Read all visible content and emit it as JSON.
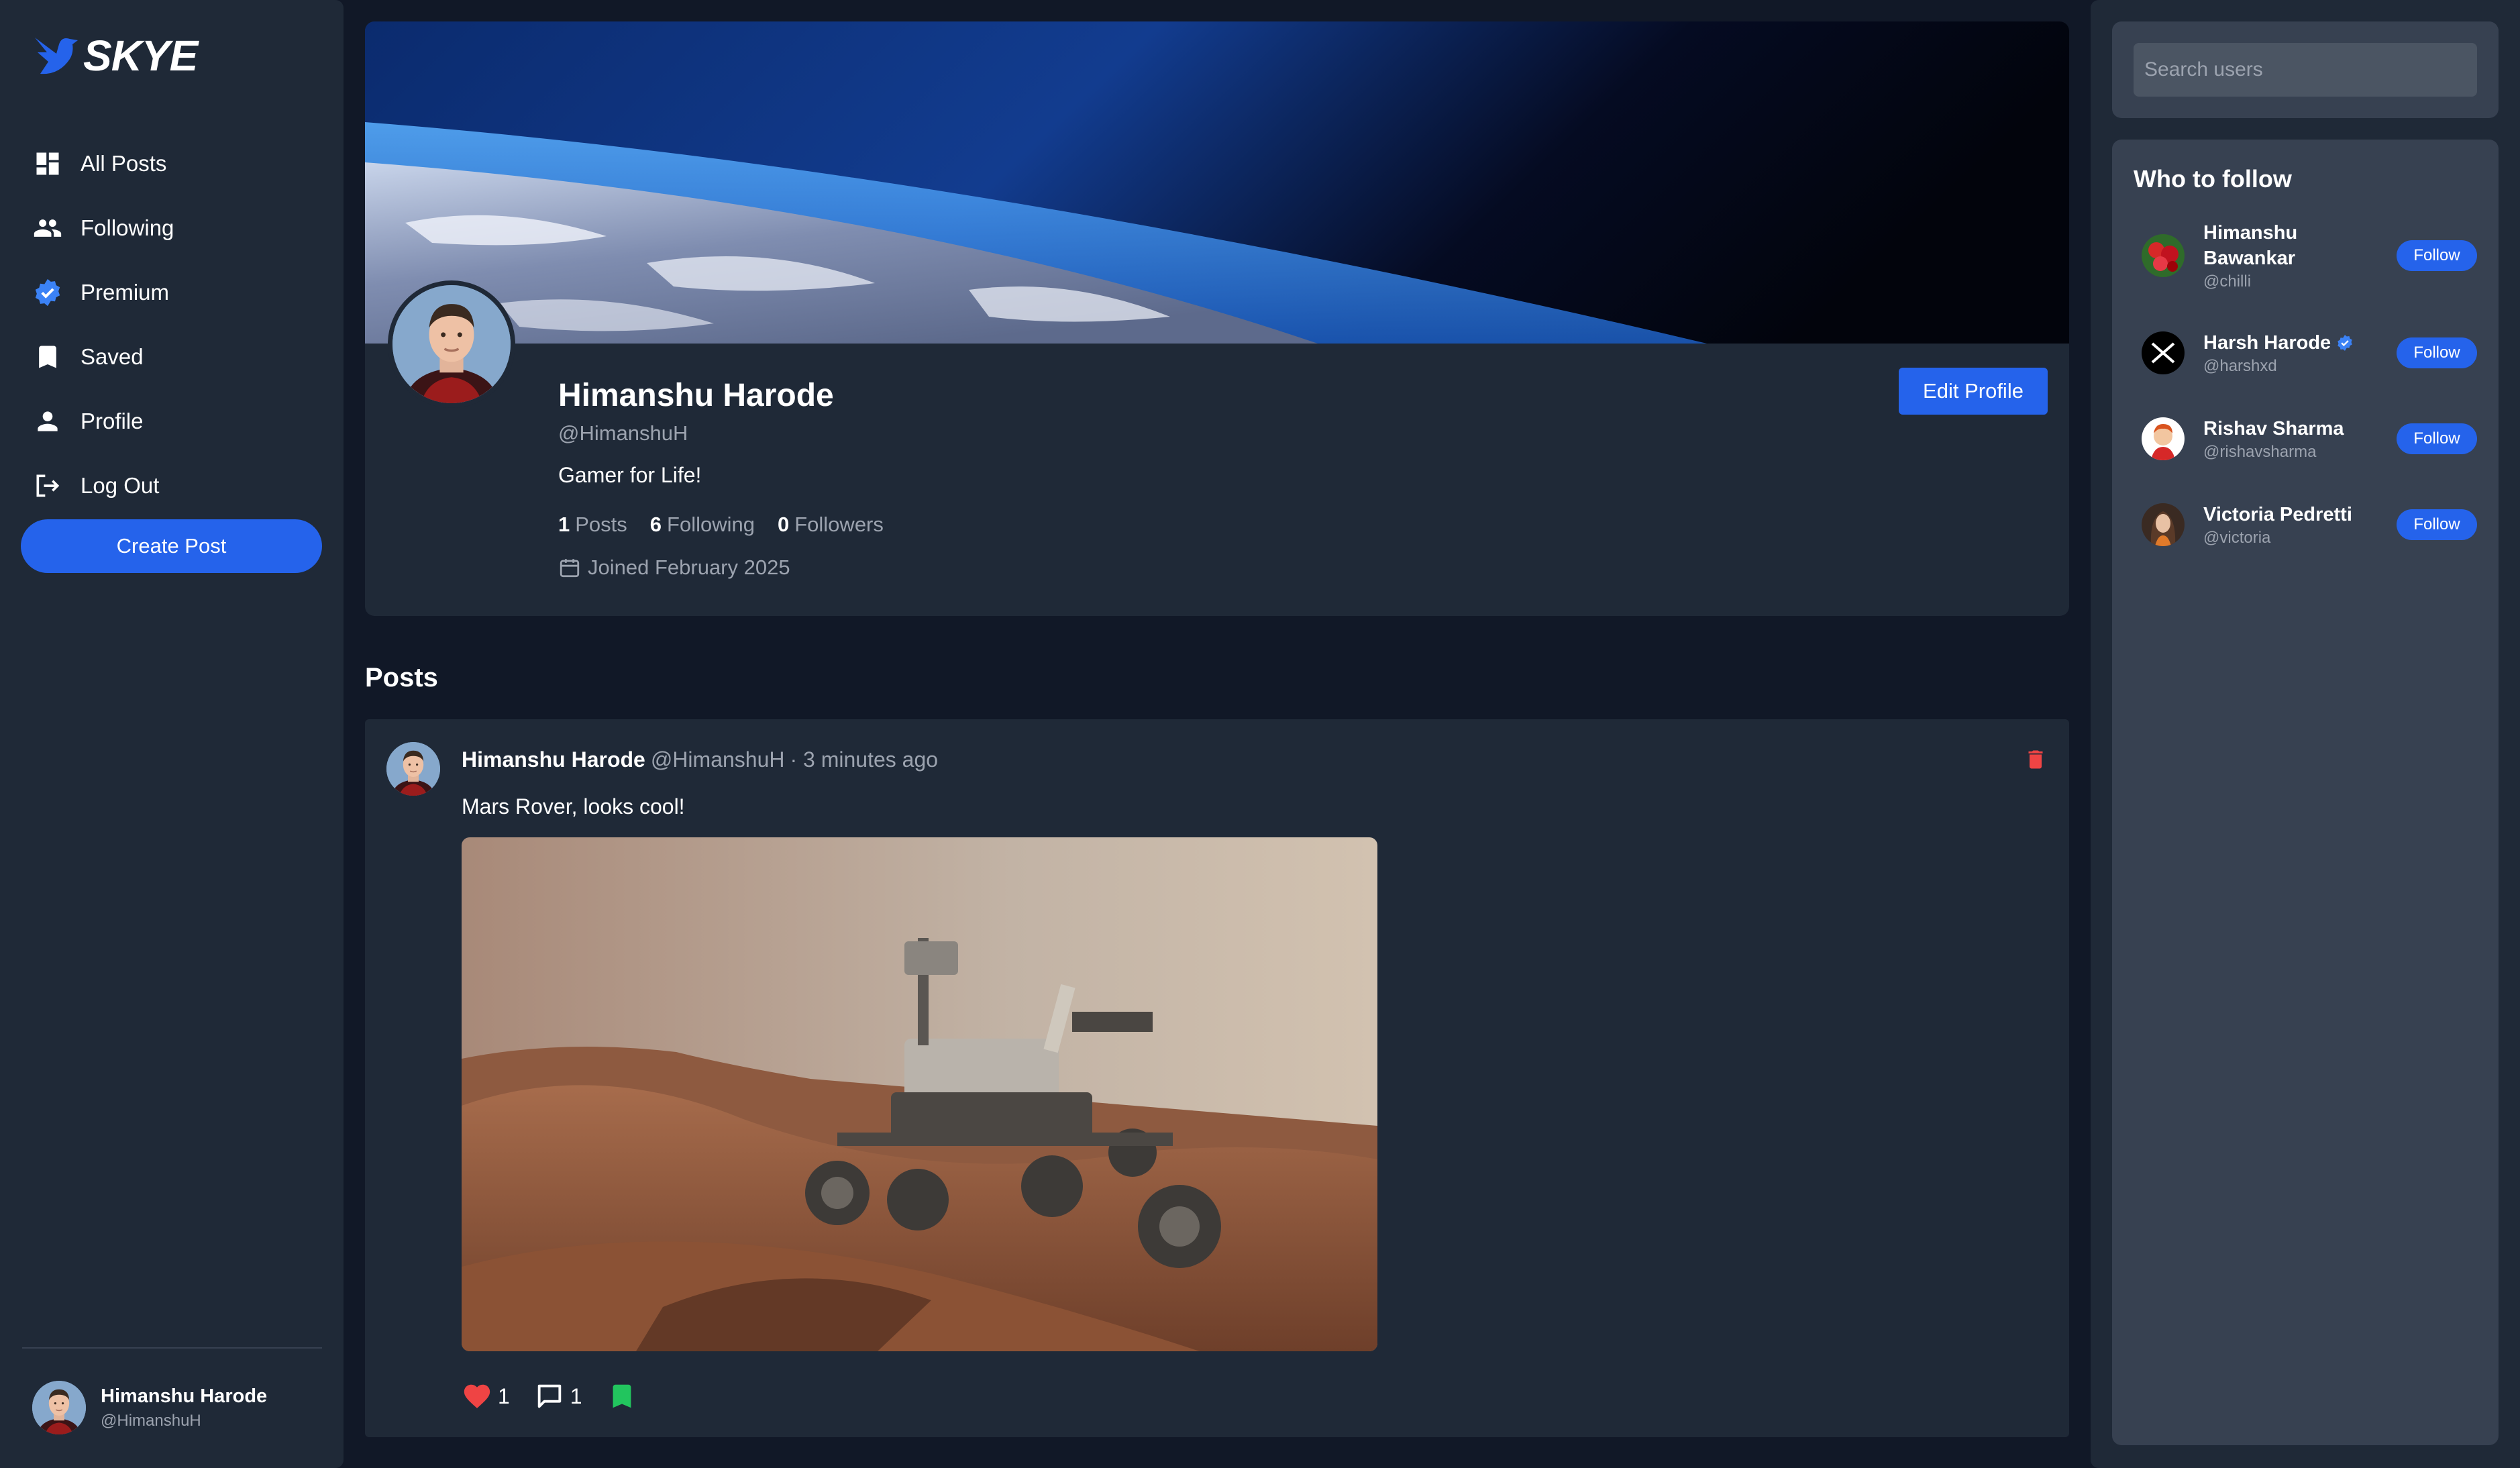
{
  "app": {
    "brand": "SKYE"
  },
  "sidebar": {
    "items": [
      {
        "label": "All Posts",
        "icon": "dashboard-icon"
      },
      {
        "label": "Following",
        "icon": "people-icon"
      },
      {
        "label": "Premium",
        "icon": "verified-badge-icon"
      },
      {
        "label": "Saved",
        "icon": "bookmark-icon"
      },
      {
        "label": "Profile",
        "icon": "person-icon"
      },
      {
        "label": "Log Out",
        "icon": "logout-icon"
      }
    ],
    "create_post_label": "Create Post",
    "current_user": {
      "name": "Himanshu Harode",
      "handle": "@HimanshuH"
    }
  },
  "profile": {
    "name": "Himanshu Harode",
    "handle": "@HimanshuH",
    "bio": "Gamer for Life!",
    "stats": {
      "posts_count": "1",
      "posts_label": "Posts",
      "following_count": "6",
      "following_label": "Following",
      "followers_count": "0",
      "followers_label": "Followers"
    },
    "joined": "Joined February 2025",
    "edit_label": "Edit Profile"
  },
  "posts": {
    "heading": "Posts",
    "items": [
      {
        "author": "Himanshu Harode",
        "handle": "@HimanshuH",
        "time": "· 3 minutes ago",
        "text": "Mars Rover, looks cool!",
        "likes": "1",
        "comments": "1"
      }
    ]
  },
  "search": {
    "placeholder": "Search users"
  },
  "who_to_follow": {
    "title": "Who to follow",
    "follow_label": "Follow",
    "users": [
      {
        "name": "Himanshu Bawankar",
        "handle": "@chilli",
        "verified": false
      },
      {
        "name": "Harsh Harode",
        "handle": "@harshxd",
        "verified": true
      },
      {
        "name": "Rishav Sharma",
        "handle": "@rishavsharma",
        "verified": false
      },
      {
        "name": "Victoria Pedretti",
        "handle": "@victoria",
        "verified": false
      }
    ]
  },
  "colors": {
    "background": "#111827",
    "panel": "#1f2937",
    "panel_light": "#374151",
    "accent": "#2563eb",
    "muted_text": "#9ca3af",
    "like": "#ef4444",
    "saved": "#22c55e",
    "delete": "#ef4444"
  }
}
